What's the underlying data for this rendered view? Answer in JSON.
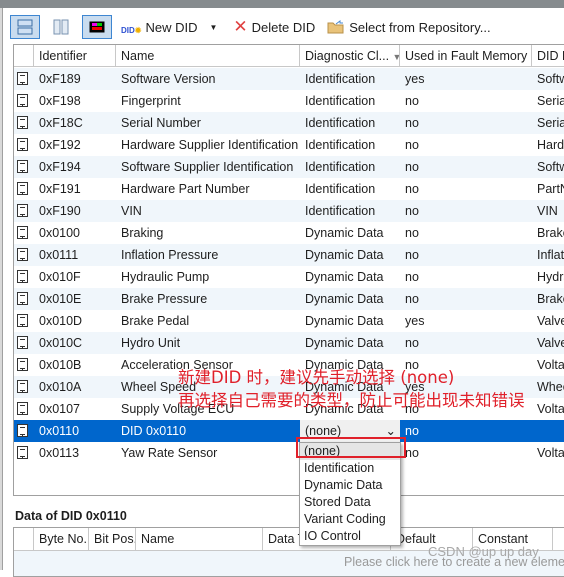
{
  "window": {
    "title": "DIDs"
  },
  "toolbar": {
    "new_did": "New DID",
    "delete_did": "Delete DID",
    "select_repo": "Select from Repository..."
  },
  "columns": [
    "Identifier",
    "Name",
    "Diagnostic Cl...",
    "Used in Fault Memory",
    "DID D"
  ],
  "rows": [
    {
      "id": "0xF189",
      "name": "Software Version",
      "cls": "Identification",
      "fault": "yes",
      "desc": "Softw"
    },
    {
      "id": "0xF198",
      "name": "Fingerprint",
      "cls": "Identification",
      "fault": "no",
      "desc": "Seria"
    },
    {
      "id": "0xF18C",
      "name": "Serial Number",
      "cls": "Identification",
      "fault": "no",
      "desc": "Seria"
    },
    {
      "id": "0xF192",
      "name": "Hardware Supplier Identification",
      "cls": "Identification",
      "fault": "no",
      "desc": "Hardv"
    },
    {
      "id": "0xF194",
      "name": "Software Supplier Identification",
      "cls": "Identification",
      "fault": "no",
      "desc": "Softw"
    },
    {
      "id": "0xF191",
      "name": "Hardware Part Number",
      "cls": "Identification",
      "fault": "no",
      "desc": "PartN"
    },
    {
      "id": "0xF190",
      "name": "VIN",
      "cls": "Identification",
      "fault": "no",
      "desc": "VIN"
    },
    {
      "id": "0x0100",
      "name": "Braking",
      "cls": "Dynamic Data",
      "fault": "no",
      "desc": "Brake"
    },
    {
      "id": "0x0111",
      "name": "Inflation Pressure",
      "cls": "Dynamic Data",
      "fault": "no",
      "desc": "Inflati"
    },
    {
      "id": "0x010F",
      "name": "Hydraulic Pump",
      "cls": "Dynamic Data",
      "fault": "no",
      "desc": "Hydra"
    },
    {
      "id": "0x010E",
      "name": "Brake Pressure",
      "cls": "Dynamic Data",
      "fault": "no",
      "desc": "Brake"
    },
    {
      "id": "0x010D",
      "name": "Brake Pedal",
      "cls": "Dynamic Data",
      "fault": "yes",
      "desc": "Valve"
    },
    {
      "id": "0x010C",
      "name": "Hydro Unit",
      "cls": "Dynamic Data",
      "fault": "no",
      "desc": "Valve"
    },
    {
      "id": "0x010B",
      "name": "Acceleration Sensor",
      "cls": "Dynamic Data",
      "fault": "no",
      "desc": "Voltag"
    },
    {
      "id": "0x010A",
      "name": "Wheel Speed",
      "cls": "Dynamic Data",
      "fault": "yes",
      "desc": "Whee"
    },
    {
      "id": "0x0107",
      "name": "Supply Voltage ECU",
      "cls": "Dynamic Data",
      "fault": "no",
      "desc": "Voltag"
    },
    {
      "id": "0x0110",
      "name": "DID 0x0110",
      "cls": "(none)",
      "fault": "no",
      "desc": "",
      "selected": true
    },
    {
      "id": "0x0113",
      "name": "Yaw Rate Sensor",
      "cls": "",
      "fault": "no",
      "desc": "Voltag"
    }
  ],
  "dropdown": {
    "options": [
      "(none)",
      "Identification",
      "Dynamic Data",
      "Stored Data",
      "Variant Coding",
      "IO Control"
    ],
    "highlighted": "(none)"
  },
  "annotation": {
    "line1": "新建DID 时，建议先手动选择 (none)",
    "line2": "再选择自己需要的类型，防止可能出现未知错误",
    "color": "#e0202a"
  },
  "data_section": {
    "title": "Data of DID 0x0110",
    "columns": [
      "Byte No.",
      "Bit Pos.",
      "Name",
      "Data Type",
      "Default",
      "Constant"
    ],
    "hint": "Please click here to create a new element"
  },
  "watermark": "CSDN @up up day",
  "colors": {
    "selection": "#0066cc",
    "alt_row": "#f0f6fb"
  }
}
